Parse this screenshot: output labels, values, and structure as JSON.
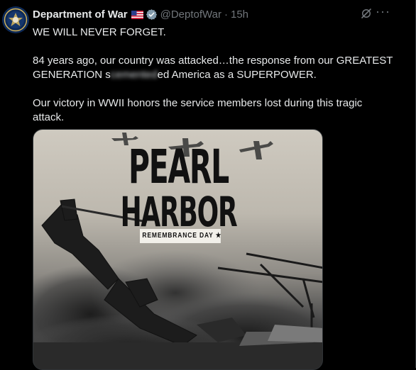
{
  "post": {
    "author_name": "Department of War",
    "handle": "@DeptofWar",
    "separator": "·",
    "time_ago": "15h",
    "more_label": "···",
    "lines": {
      "l1": "WE WILL NEVER FORGET.",
      "l2": "84 years ago, our country was attacked…the response from our GREATEST",
      "l3a": "GENERATION s",
      "l3b": "cemented",
      "l3c": "ed America as a SUPERPOWER.",
      "l4": "Our victory in WWII honors the service members lost during this tragic",
      "l5": "attack."
    }
  },
  "media": {
    "title_line1": "PEARL",
    "title_line2": "HARBOR",
    "subtitle": "REMEMBRANCE DAY ★"
  },
  "icons": {
    "verified": "verified-badge-icon",
    "flag": "us-flag-icon",
    "grok": "grok-icon",
    "more": "more-options-icon",
    "avatar": "department-seal-avatar"
  },
  "colors": {
    "background": "#000000",
    "text": "#e7e9ea",
    "muted": "#71767b",
    "verified": "#829aab"
  }
}
